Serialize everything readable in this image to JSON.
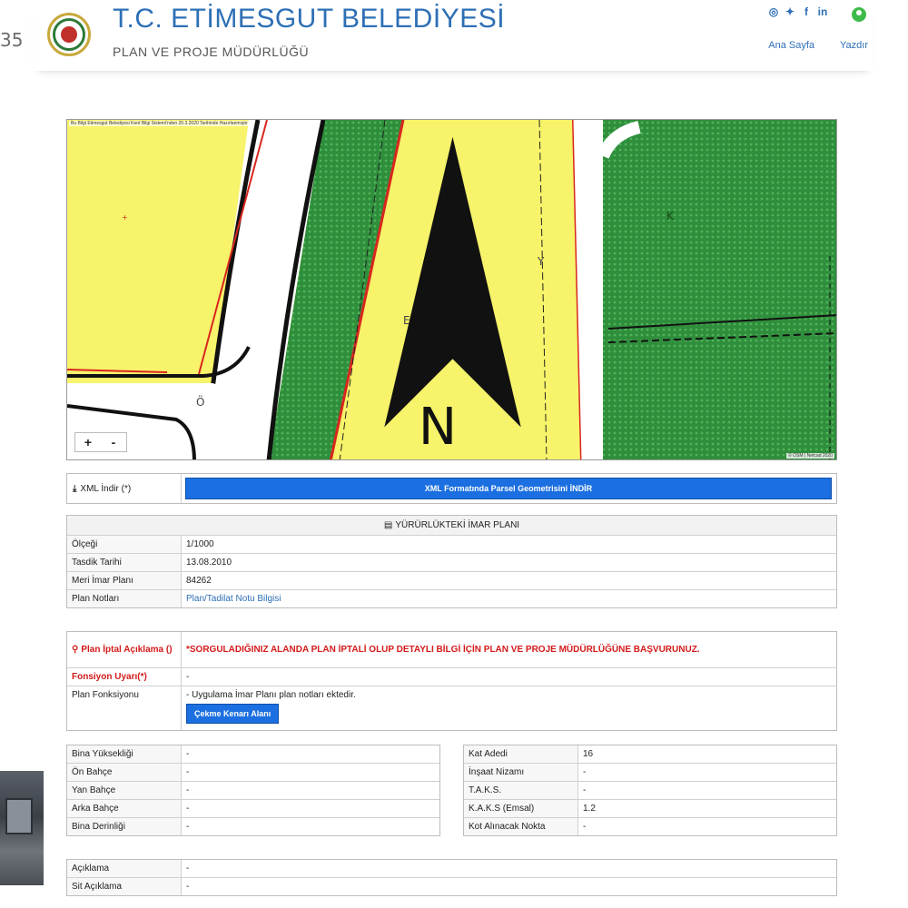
{
  "fragments": {
    "page_number": "35"
  },
  "header": {
    "title": "T.C. ETİMESGUT BELEDİYESİ",
    "subtitle": "PLAN VE PROJE MÜDÜRLÜĞÜ",
    "social_icons": [
      "instagram-icon",
      "twitter-icon",
      "facebook-icon",
      "linkedin-icon"
    ],
    "nav": [
      "Ana Sayfa",
      "Yazdır"
    ]
  },
  "map": {
    "note": "Bu Bilgi Etimesgut Belediyesi Kent Bilgi Sistemi'nden 20.3.2020 Tarihinde Hazırlanmıştır",
    "attribution": "© OSM | Netcad 2020",
    "zoom_in": "+",
    "zoom_out": "-",
    "labels": [
      "E",
      "K",
      "Y",
      "K",
      "Ö"
    ],
    "colors": {
      "residential": "#f8f56a",
      "green": "#2d8a3a",
      "road": "#ffffff",
      "border_red": "#d8261e",
      "border_black": "#111111"
    }
  },
  "xml": {
    "label": "XML İndir (*)",
    "button": "XML Formatında Parsel Geometrisini İNDİR"
  },
  "plan": {
    "heading": "YÜRÜRLÜKTEKİ İMAR PLANI",
    "rows": [
      {
        "label": "Ölçeği",
        "value": "1/1000"
      },
      {
        "label": "Tasdik Tarihi",
        "value": "13.08.2010"
      },
      {
        "label": "Meri İmar Planı",
        "value": "84262"
      },
      {
        "label": "Plan Notları",
        "value": "Plan/Tadilat Notu Bilgisi"
      }
    ]
  },
  "iptal": {
    "label": "Plan İptal Açıklama ()",
    "text": "*SORGULADIĞINIZ ALANDA PLAN İPTALİ OLUP DETAYLI BİLGİ İÇİN PLAN VE PROJE MÜDÜRLÜĞÜNE BAŞVURUNUZ.",
    "fonksiyon_label": "Fonsiyon Uyarı(*)",
    "fonksiyon_value": "-",
    "plan_fonk_label": "Plan Fonksiyonu",
    "plan_fonk_value": "- Uygulama İmar Planı plan notları ektedir.",
    "cekme_button": "Çekme Kenarı Alanı"
  },
  "left_rows": [
    {
      "label": "Bina Yüksekliği",
      "value": "-"
    },
    {
      "label": "Ön Bahçe",
      "value": "-"
    },
    {
      "label": "Yan Bahçe",
      "value": "-"
    },
    {
      "label": "Arka Bahçe",
      "value": "-"
    },
    {
      "label": "Bina Derinliği",
      "value": "-"
    }
  ],
  "right_rows": [
    {
      "label": "Kat Adedi",
      "value": "16"
    },
    {
      "label": "İnşaat Nizamı",
      "value": "-"
    },
    {
      "label": "T.A.K.S.",
      "value": "-"
    },
    {
      "label": "K.A.K.S (Emsal)",
      "value": "1.2"
    },
    {
      "label": "Kot Alınacak Nokta",
      "value": "-"
    }
  ],
  "bottom_rows": [
    {
      "label": "Açıklama",
      "value": "-"
    },
    {
      "label": "Sit Açıklama",
      "value": "-"
    }
  ]
}
